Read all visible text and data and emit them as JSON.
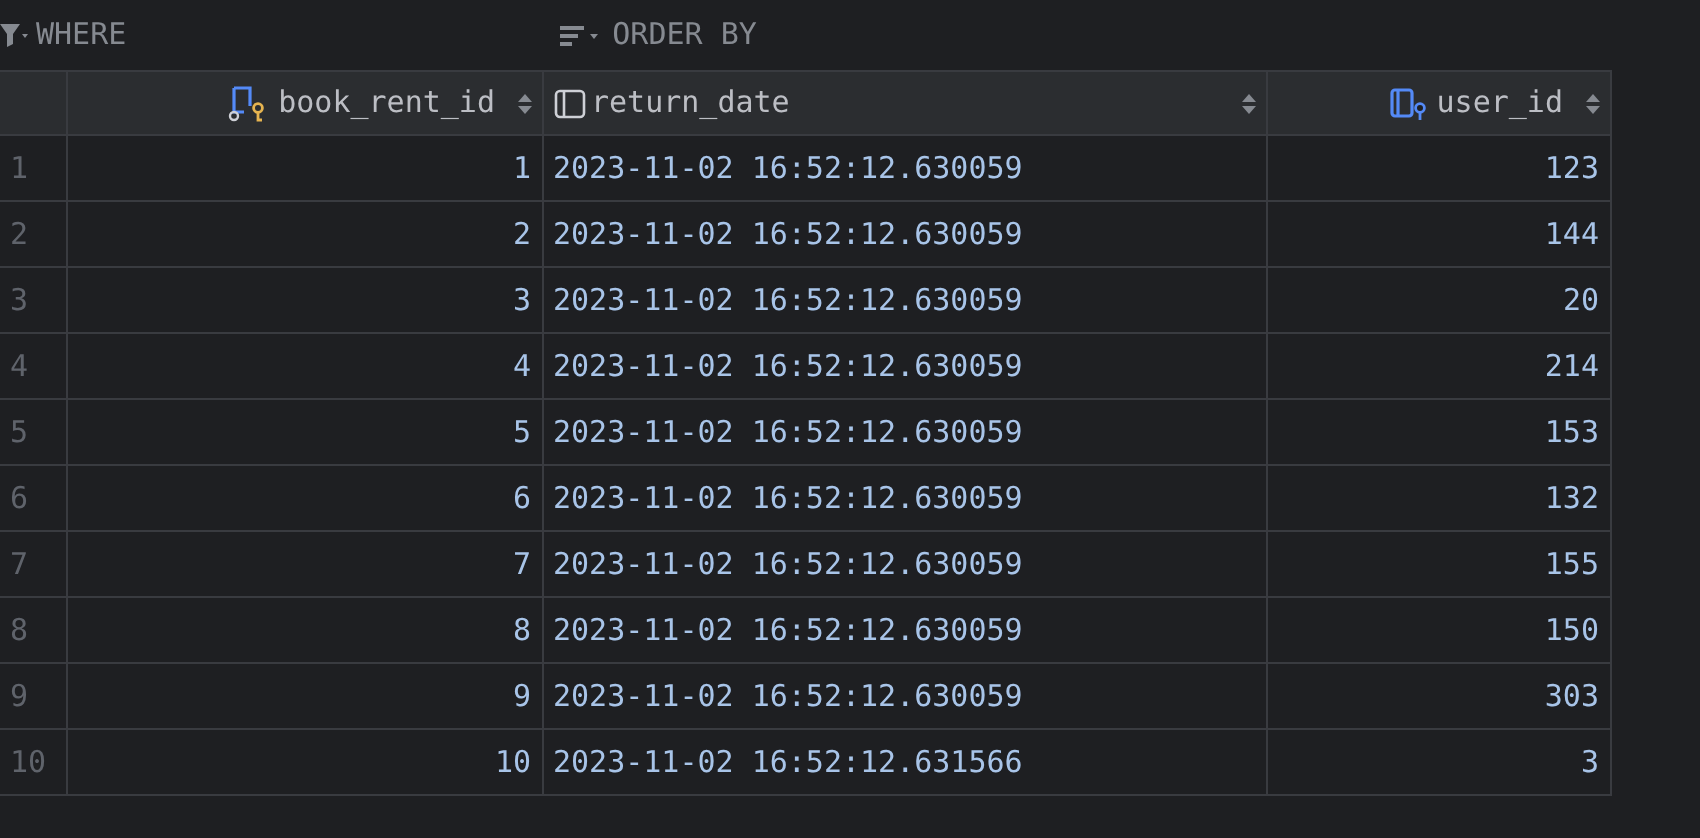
{
  "filter_bar": {
    "where": "WHERE",
    "order_by": "ORDER BY"
  },
  "table": {
    "columns": [
      {
        "name": "book_rent_id",
        "kind": "key"
      },
      {
        "name": "return_date",
        "kind": "plain"
      },
      {
        "name": "user_id",
        "kind": "foreign"
      }
    ],
    "rows": [
      {
        "number": "1",
        "cells": [
          "1",
          "2023-11-02 16:52:12.630059",
          "123"
        ]
      },
      {
        "number": "2",
        "cells": [
          "2",
          "2023-11-02 16:52:12.630059",
          "144"
        ]
      },
      {
        "number": "3",
        "cells": [
          "3",
          "2023-11-02 16:52:12.630059",
          "20"
        ]
      },
      {
        "number": "4",
        "cells": [
          "4",
          "2023-11-02 16:52:12.630059",
          "214"
        ]
      },
      {
        "number": "5",
        "cells": [
          "5",
          "2023-11-02 16:52:12.630059",
          "153"
        ]
      },
      {
        "number": "6",
        "cells": [
          "6",
          "2023-11-02 16:52:12.630059",
          "132"
        ]
      },
      {
        "number": "7",
        "cells": [
          "7",
          "2023-11-02 16:52:12.630059",
          "155"
        ]
      },
      {
        "number": "8",
        "cells": [
          "8",
          "2023-11-02 16:52:12.630059",
          "150"
        ]
      },
      {
        "number": "9",
        "cells": [
          "9",
          "2023-11-02 16:52:12.630059",
          "303"
        ]
      },
      {
        "number": "10",
        "cells": [
          "10",
          "2023-11-02 16:52:12.631566",
          "3"
        ]
      }
    ]
  }
}
